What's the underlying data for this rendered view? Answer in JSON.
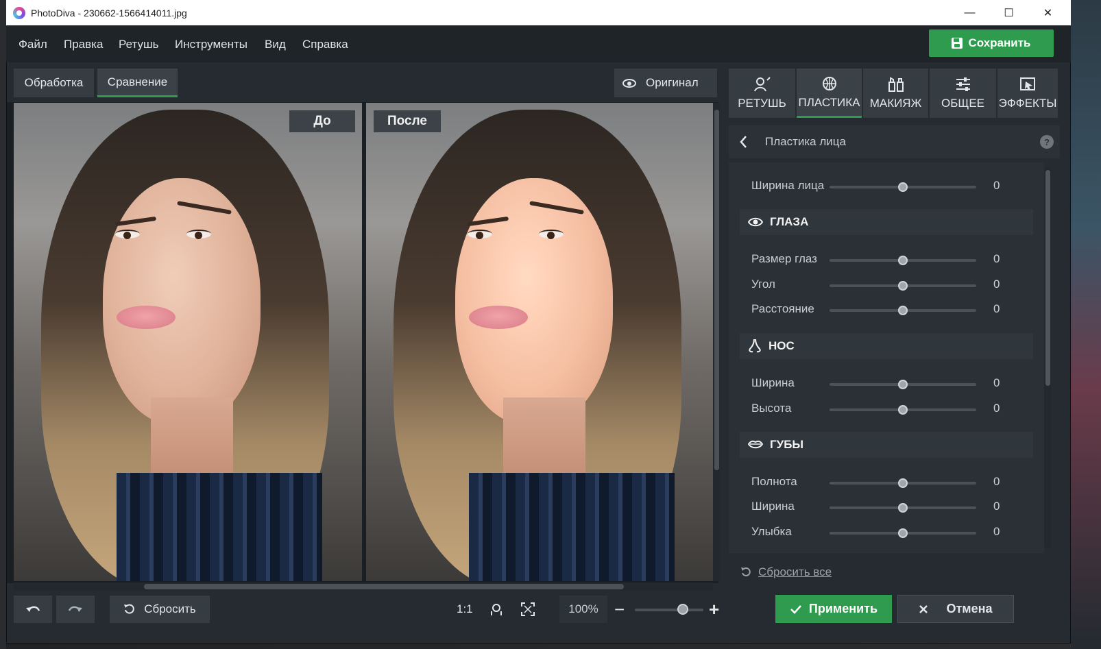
{
  "window": {
    "title": "PhotoDiva - 230662-1566414011.jpg",
    "controls": {
      "minimize": "—",
      "maximize": "☐",
      "close": "✕"
    }
  },
  "menu": {
    "items": [
      "Файл",
      "Правка",
      "Ретушь",
      "Инструменты",
      "Вид",
      "Справка"
    ],
    "save_label": "Сохранить"
  },
  "view_tabs": {
    "tabs": [
      {
        "label": "Обработка",
        "active": false
      },
      {
        "label": "Сравнение",
        "active": true
      }
    ],
    "original_label": "Оригинал"
  },
  "compare": {
    "before_label": "До",
    "after_label": "После"
  },
  "bottom_toolbar": {
    "reset_label": "Сбросить",
    "ratio_label": "1:1",
    "zoom_value": "100%",
    "zoom_level_fraction": 0.7
  },
  "tool_tabs": [
    {
      "label": "РЕТУШЬ",
      "icon": "retouch-brush-icon",
      "active": false
    },
    {
      "label": "ПЛАСТИКА",
      "icon": "plastic-icon",
      "active": true
    },
    {
      "label": "МАКИЯЖ",
      "icon": "makeup-icon",
      "active": false
    },
    {
      "label": "ОБЩЕЕ",
      "icon": "sliders-icon",
      "active": false
    },
    {
      "label": "ЭФФЕКТЫ",
      "icon": "effects-icon",
      "active": false
    }
  ],
  "panel": {
    "back_icon": "chevron-left-icon",
    "title": "Пластика лица",
    "help": "?",
    "face_width": {
      "label": "Ширина лица",
      "value": "0"
    },
    "sections": [
      {
        "title": "ГЛАЗА",
        "icon": "eye-icon",
        "rows": [
          {
            "label": "Размер глаз",
            "value": "0"
          },
          {
            "label": "Угол",
            "value": "0"
          },
          {
            "label": "Расстояние",
            "value": "0"
          }
        ]
      },
      {
        "title": "НОС",
        "icon": "nose-icon",
        "rows": [
          {
            "label": "Ширина",
            "value": "0"
          },
          {
            "label": "Высота",
            "value": "0"
          }
        ]
      },
      {
        "title": "ГУБЫ",
        "icon": "lips-icon",
        "rows": [
          {
            "label": "Полнота",
            "value": "0"
          },
          {
            "label": "Ширина",
            "value": "0"
          },
          {
            "label": "Улыбка",
            "value": "0"
          }
        ]
      }
    ],
    "reset_all_label": "Сбросить все",
    "apply_label": "Применить",
    "cancel_label": "Отмена"
  },
  "colors": {
    "accent": "#2f9b4e",
    "background": "#252b30",
    "panel": "#353c42"
  }
}
